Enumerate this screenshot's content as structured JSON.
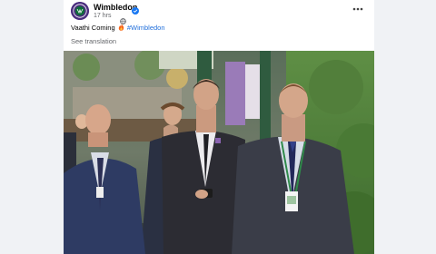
{
  "post": {
    "author": "Wimbledon",
    "timestamp": "17 hrs",
    "text": "Vaathi Coming",
    "hashtag": "#Wimbledon",
    "see_translation": "See translation"
  },
  "icons": {
    "avatar": "wimbledon-logo",
    "verified": "verified-badge-icon",
    "privacy": "globe-icon",
    "more": "more-options-icon",
    "emoji": "fire-emoji"
  },
  "colors": {
    "verified": "#1877f2",
    "hashtag": "#216fdb",
    "brand": "#4b2d7f"
  }
}
